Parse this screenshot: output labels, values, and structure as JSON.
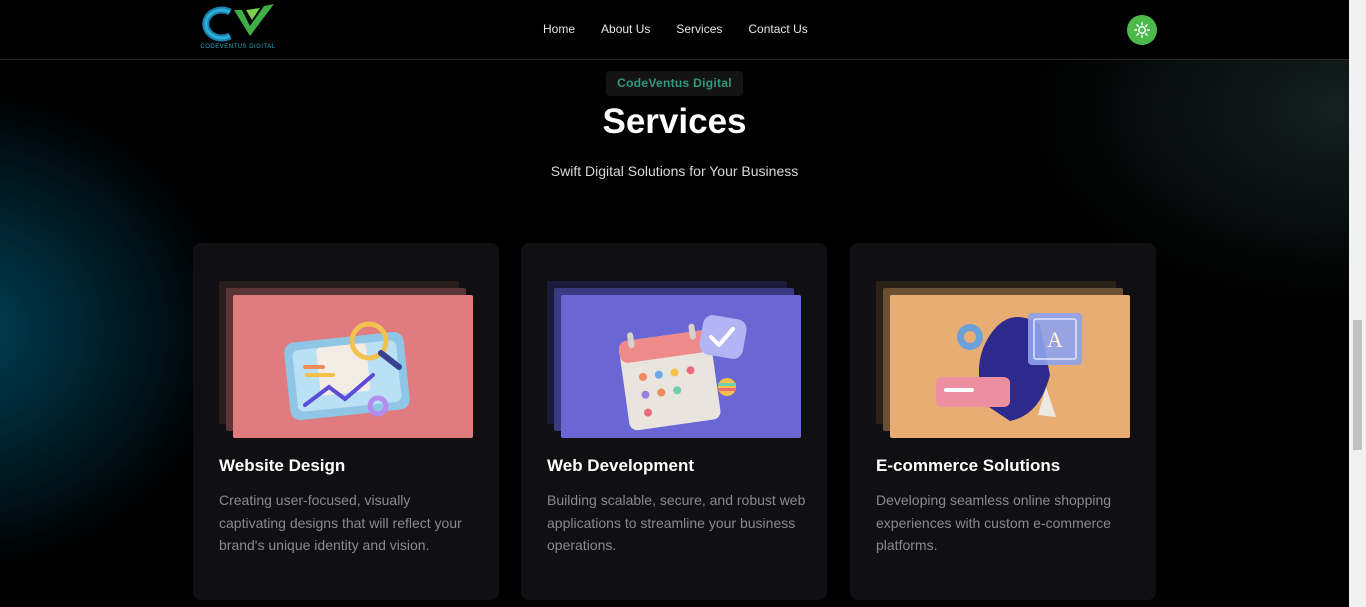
{
  "brand": {
    "logo_text": "CODEVENTUS DIGITAL"
  },
  "nav": [
    "Home",
    "About Us",
    "Services",
    "Contact Us"
  ],
  "hero": {
    "badge": "CodeVentus Digital",
    "title": "Services",
    "subtitle": "Swift Digital Solutions for Your Business"
  },
  "cards": [
    {
      "title": "Website Design",
      "desc": "Creating user-focused, visually captivating designs that will reflect your brand's unique identity and vision.",
      "icon": "website-design-illustration",
      "color": "#e07b7f"
    },
    {
      "title": "Web Development",
      "desc": "Building scalable, secure, and robust web applications to streamline your business operations.",
      "icon": "calendar-check-illustration",
      "color": "#6a67d4"
    },
    {
      "title": "E-commerce Solutions",
      "desc": "Developing seamless online shopping experiences with custom e-commerce platforms.",
      "icon": "abstract-shapes-illustration",
      "color": "#e8ad72"
    }
  ],
  "colors": {
    "accent": "#4cba4a",
    "badge_text": "#2f9b7c"
  }
}
